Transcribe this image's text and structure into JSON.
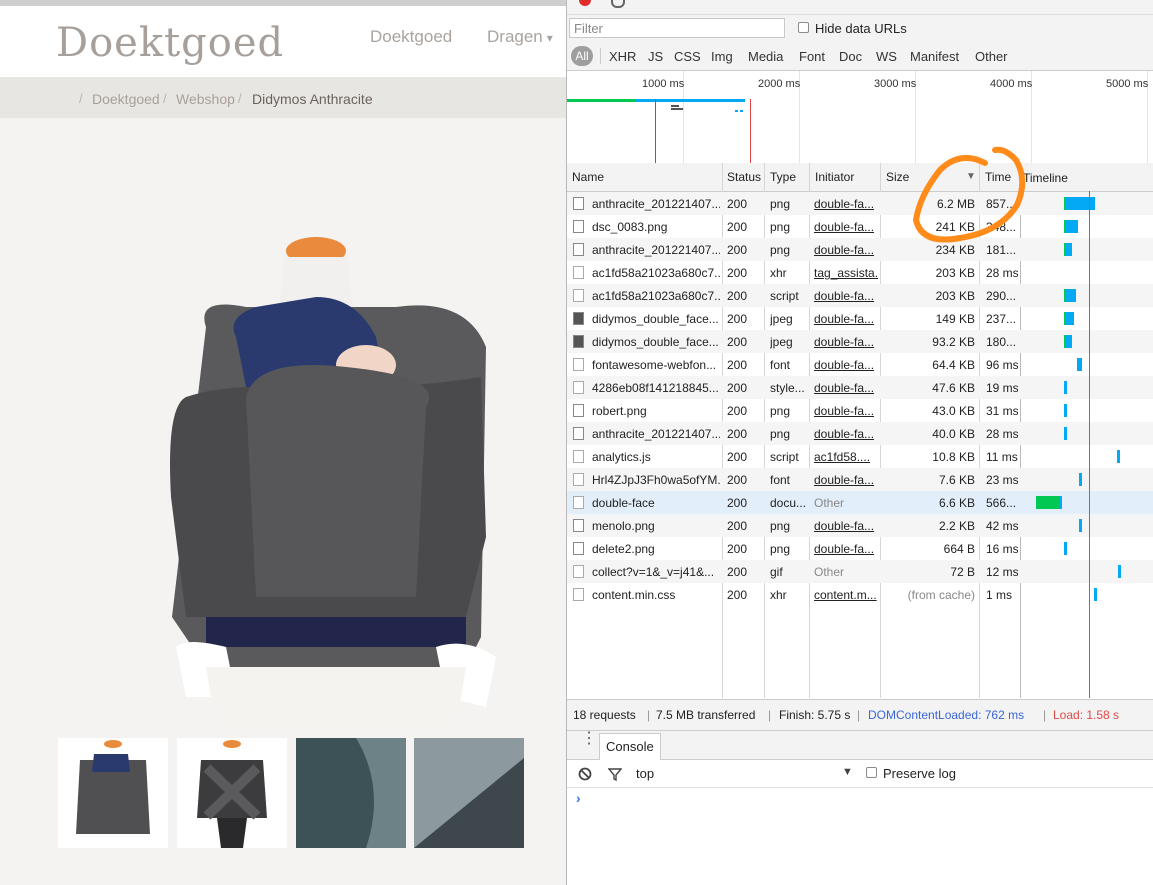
{
  "site": {
    "logo": "Doektgoed",
    "nav": [
      {
        "label": "Doektgoed"
      },
      {
        "label": "Dragen",
        "caret": "▾"
      }
    ],
    "breadcrumb": [
      {
        "label": "Doektgoed"
      },
      {
        "label": "Webshop"
      },
      {
        "label": "Didymos Anthracite"
      }
    ],
    "breadcrumb_separator": "/"
  },
  "devtools": {
    "filter_placeholder": "Filter",
    "hide_data_urls": "Hide data URLs",
    "type_filters": [
      "All",
      "XHR",
      "JS",
      "CSS",
      "Img",
      "Media",
      "Font",
      "Doc",
      "WS",
      "Manifest",
      "Other"
    ],
    "overview_ticks": [
      "1000 ms",
      "2000 ms",
      "3000 ms",
      "4000 ms",
      "5000 ms"
    ],
    "columns": {
      "name": "Name",
      "status": "Status",
      "type": "Type",
      "initiator": "Initiator",
      "size": "Size",
      "time": "Time",
      "timeline": "Timeline",
      "sort_indicator": "▼"
    },
    "requests": [
      {
        "name": "anthracite_201221407...",
        "status": "200",
        "type": "png",
        "initiator": "double-fa...",
        "size": "6.2 MB",
        "time": "857...",
        "bar_start_ms": 400,
        "bar_wait_ms": 20,
        "bar_dl_ms": 857,
        "icon": "image-file-icon"
      },
      {
        "name": "dsc_0083.png",
        "status": "200",
        "type": "png",
        "initiator": "double-fa...",
        "size": "241 KB",
        "time": "348...",
        "bar_start_ms": 400,
        "bar_wait_ms": 20,
        "bar_dl_ms": 348,
        "icon": "image-file-icon"
      },
      {
        "name": "anthracite_201221407...",
        "status": "200",
        "type": "png",
        "initiator": "double-fa...",
        "size": "234 KB",
        "time": "181...",
        "bar_start_ms": 400,
        "bar_wait_ms": 20,
        "bar_dl_ms": 181,
        "icon": "image-file-icon"
      },
      {
        "name": "ac1fd58a21023a680c7...",
        "status": "200",
        "type": "xhr",
        "initiator": "tag_assista...",
        "size": "203 KB",
        "time": "28 ms",
        "bar_start_ms": null,
        "bar_wait_ms": 0,
        "bar_dl_ms": 0,
        "icon": "blank-file-icon"
      },
      {
        "name": "ac1fd58a21023a680c7...",
        "status": "200",
        "type": "script",
        "initiator": "double-fa...",
        "size": "203 KB",
        "time": "290...",
        "bar_start_ms": 400,
        "bar_wait_ms": 20,
        "bar_dl_ms": 290,
        "icon": "script-file-icon"
      },
      {
        "name": "didymos_double_face...",
        "status": "200",
        "type": "jpeg",
        "initiator": "double-fa...",
        "size": "149 KB",
        "time": "237...",
        "bar_start_ms": 400,
        "bar_wait_ms": 20,
        "bar_dl_ms": 237,
        "icon": "photo-file-icon"
      },
      {
        "name": "didymos_double_face...",
        "status": "200",
        "type": "jpeg",
        "initiator": "double-fa...",
        "size": "93.2 KB",
        "time": "180...",
        "bar_start_ms": 400,
        "bar_wait_ms": 20,
        "bar_dl_ms": 180,
        "icon": "photo-file-icon"
      },
      {
        "name": "fontawesome-webfon...",
        "status": "200",
        "type": "font",
        "initiator": "double-fa...",
        "size": "64.4 KB",
        "time": "96 ms",
        "bar_start_ms": 590,
        "bar_wait_ms": 15,
        "bar_dl_ms": 96,
        "icon": "blank-file-icon"
      },
      {
        "name": "4286eb08f141218845...",
        "status": "200",
        "type": "style...",
        "initiator": "double-fa...",
        "size": "47.6 KB",
        "time": "19 ms",
        "bar_start_ms": 400,
        "bar_wait_ms": 0,
        "bar_dl_ms": 30,
        "icon": "script-file-icon"
      },
      {
        "name": "robert.png",
        "status": "200",
        "type": "png",
        "initiator": "double-fa...",
        "size": "43.0 KB",
        "time": "31 ms",
        "bar_start_ms": 400,
        "bar_wait_ms": 0,
        "bar_dl_ms": 31,
        "icon": "image-file-icon"
      },
      {
        "name": "anthracite_201221407...",
        "status": "200",
        "type": "png",
        "initiator": "double-fa...",
        "size": "40.0 KB",
        "time": "28 ms",
        "bar_start_ms": 400,
        "bar_wait_ms": 0,
        "bar_dl_ms": 30,
        "icon": "image-file-icon"
      },
      {
        "name": "analytics.js",
        "status": "200",
        "type": "script",
        "initiator": "ac1fd58....",
        "size": "10.8 KB",
        "time": "11 ms",
        "bar_start_ms": 1150,
        "bar_wait_ms": 0,
        "bar_dl_ms": 30,
        "icon": "script-file-icon"
      },
      {
        "name": "Hrl4ZJpJ3Fh0wa5ofYM...",
        "status": "200",
        "type": "font",
        "initiator": "double-fa...",
        "size": "7.6 KB",
        "time": "23 ms",
        "bar_start_ms": 610,
        "bar_wait_ms": 0,
        "bar_dl_ms": 30,
        "icon": "blank-file-icon"
      },
      {
        "name": "double-face",
        "status": "200",
        "type": "docu...",
        "initiator": "Other",
        "size": "6.6 KB",
        "time": "566...",
        "bar_start_ms": 0,
        "bar_wait_ms": 330,
        "bar_dl_ms": 60,
        "icon": "document-file-icon",
        "selected": true
      },
      {
        "name": "menolo.png",
        "status": "200",
        "type": "png",
        "initiator": "double-fa...",
        "size": "2.2 KB",
        "time": "42 ms",
        "bar_start_ms": 610,
        "bar_wait_ms": 0,
        "bar_dl_ms": 35,
        "icon": "image-file-icon"
      },
      {
        "name": "delete2.png",
        "status": "200",
        "type": "png",
        "initiator": "double-fa...",
        "size": "664 B",
        "time": "16 ms",
        "bar_start_ms": 400,
        "bar_wait_ms": 0,
        "bar_dl_ms": 30,
        "icon": "delete-file-icon"
      },
      {
        "name": "collect?v=1&_v=j41&...",
        "status": "200",
        "type": "gif",
        "initiator": "Other",
        "size": "72 B",
        "time": "12 ms",
        "bar_start_ms": 1170,
        "bar_wait_ms": 0,
        "bar_dl_ms": 30,
        "icon": "blank-file-icon"
      },
      {
        "name": "content.min.css",
        "status": "200",
        "type": "xhr",
        "initiator": "content.m...",
        "size": "(from cache)",
        "time": "1 ms",
        "bar_start_ms": 830,
        "bar_wait_ms": 0,
        "bar_dl_ms": 30,
        "icon": "blank-file-icon"
      }
    ],
    "summary": {
      "requests": "18 requests",
      "transferred": "7.5 MB transferred",
      "finish": "Finish: 5.75 s",
      "dcl": "DOMContentLoaded: 762 ms",
      "load": "Load: 1.58 s",
      "sep": "|"
    },
    "console": {
      "tab": "Console",
      "context": "top",
      "preserve_log": "Preserve log",
      "prompt": "›"
    },
    "colors": {
      "waiting": "#00c853",
      "download": "#03a9f4",
      "dcl": "#3a66d8",
      "load": "#e04848",
      "annotation": "#ff8c1a"
    }
  }
}
